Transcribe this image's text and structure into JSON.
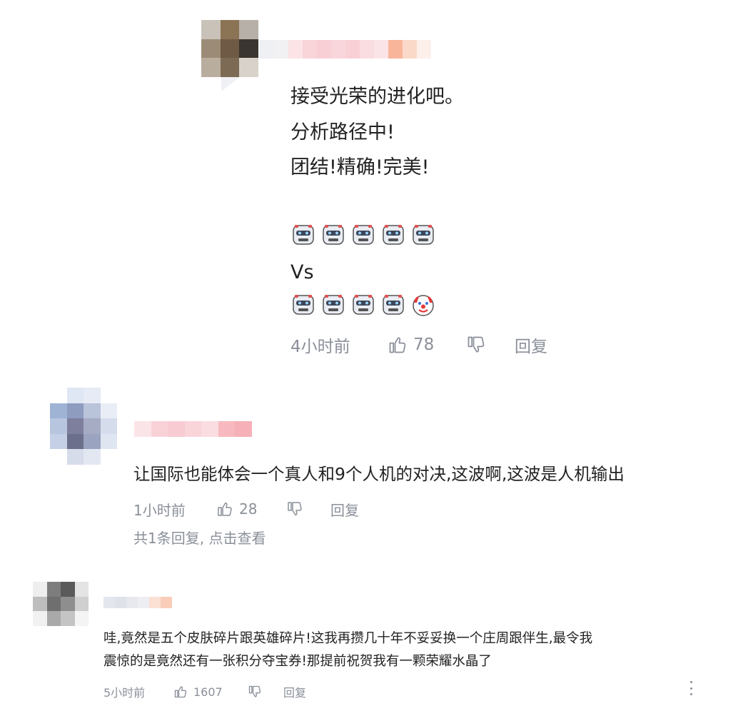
{
  "comments": [
    {
      "lines": [
        "接受光荣的进化吧。",
        "分析路径中!",
        "团结!精确!完美!"
      ],
      "emoji_rows": [
        [
          "robot-face-icon",
          "robot-face-icon",
          "robot-face-icon",
          "robot-face-icon",
          "robot-face-icon"
        ],
        [
          "robot-face-icon",
          "robot-face-icon",
          "robot-face-icon",
          "robot-face-icon",
          "clown-face-icon"
        ]
      ],
      "vs_text": "Vs",
      "time": "4小时前",
      "likes": "78",
      "reply_label": "回复"
    },
    {
      "text": "让国际也能体会一个真人和9个人机的对决,这波啊,这波是人机输出",
      "time": "1小时前",
      "likes": "28",
      "reply_label": "回复",
      "replies_link": "共1条回复, 点击查看"
    },
    {
      "lines": [
        "哇,竟然是五个皮肤碎片跟英雄碎片!这我再攒几十年不妥妥换一个庄周跟伴生,最令我",
        "震惊的是竟然还有一张积分夺宝券!那提前祝贺我有一颗荣耀水晶了"
      ],
      "time": "5小时前",
      "likes": "1607",
      "reply_label": "回复"
    }
  ],
  "colors": {
    "meta_gray": "#8a8f99",
    "text": "#222222",
    "blur_pink": "#f7c8cf",
    "blur_orange": "#f8b59a"
  }
}
